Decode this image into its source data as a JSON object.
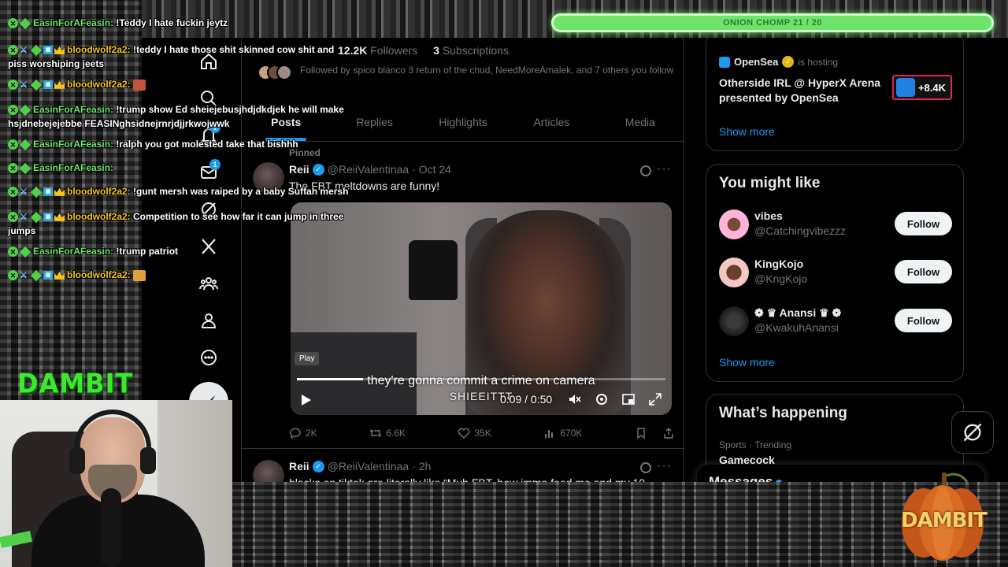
{
  "stream_overlay": {
    "chomp_bar_label": "ONION CHOMP 21 / 20",
    "channel_logo_text": "DAMBIT",
    "pumpkin_text": "DAMBIT",
    "colors": {
      "chat_green": "#6ee36a",
      "chat_gold": "#f5c518",
      "chomp_bar": "#6ee36a"
    }
  },
  "chat": {
    "messages": [
      {
        "user": "EasinForAFeasin:",
        "text": "!Teddy I hate fuckin jeytz",
        "style": "green"
      },
      {
        "user": "bloodwolf2a2:",
        "text": "!teddy I hate those shit skinned cow shit and piss worshiping jeets",
        "style": "gold"
      },
      {
        "user": "bloodwolf2a2:",
        "text": "",
        "style": "gold",
        "emote": true
      },
      {
        "user": "EasinForAFeasin:",
        "text": "!trump show Ed sheiejebusjhdjdkdjek he will make hsjdnebejejebbe FEASINghsidnejrnrjdjjrkwojwwk",
        "style": "green"
      },
      {
        "user": "EasinForAFeasin:",
        "text": "!ralph you got molested take that bishhh",
        "style": "green"
      },
      {
        "user": "EasinForAFeasin:",
        "text": "",
        "style": "green"
      },
      {
        "user": "bloodwolf2a2:",
        "text": "!gunt mersh was raiped by a baby Suffah mersh",
        "style": "gold"
      },
      {
        "user": "bloodwolf2a2:",
        "text": "Competition to see how far it can jump in three jumps",
        "style": "gold"
      },
      {
        "user": "EasinForAFeasin:",
        "text": "!trump patriot",
        "style": "green"
      },
      {
        "user": "bloodwolf2a2:",
        "text": "",
        "style": "gold",
        "emote": true
      }
    ]
  },
  "x_nav": {
    "icons": [
      "home-icon",
      "search-icon",
      "notifications-icon",
      "messages-icon",
      "grok-icon",
      "x-logo-icon",
      "communities-icon",
      "profile-icon",
      "more-icon"
    ],
    "notifications_badge": "1",
    "messages_badge": "1"
  },
  "profile": {
    "followers_count": "12.2K",
    "followers_label": "Followers",
    "subscriptions_count": "3",
    "subscriptions_label": "Subscriptions",
    "followed_by": "Followed by spico blanco 3 return of the chud, NeedMoreAmalek, and 7 others you follow",
    "tabs": [
      "Posts",
      "Replies",
      "Highlights",
      "Articles",
      "Media"
    ],
    "active_tab": "Posts"
  },
  "tweets": [
    {
      "pinned_label": "Pinned",
      "name": "Reii",
      "handle": "@ReiiValentinaa",
      "date": "· Oct 24",
      "text": "The FBT meltdowns are funny!",
      "video": {
        "caption": "they're gonna commit a crime on camera",
        "watermark": "SHIEEITTT",
        "play_tooltip": "Play",
        "time": "0:09 / 0:50",
        "progress": 0.18
      },
      "stats": {
        "replies": "2K",
        "reposts": "6.6K",
        "likes": "35K",
        "views": "670K"
      }
    },
    {
      "name": "Reii",
      "handle": "@ReiiValentinaa",
      "date": "· 2h",
      "text": "blacks on tiktok are literally like “Muh FBT, how imma feed me and my 10"
    }
  ],
  "sidebar": {
    "event": {
      "host_name": "OpenSea",
      "host_suffix": "is hosting",
      "title": "Otherside IRL @ HyperX Arena presented by OpenSea",
      "count": "+8.4K",
      "show_more": "Show more"
    },
    "you_might_like": {
      "title": "You might like",
      "accounts": [
        {
          "name": "vibes",
          "handle": "@Catchingvibezzz",
          "follow": "Follow"
        },
        {
          "name": "KingKojo",
          "handle": "@KngKojo",
          "follow": "Follow"
        },
        {
          "name": "❁ ♛ Anansi ♛ ❁",
          "handle": "@KwakuhAnansi",
          "follow": "Follow"
        }
      ],
      "show_more": "Show more"
    },
    "happening": {
      "title": "What’s happening",
      "trend_meta": "Sports · Trending",
      "trend_name": "Gamecock"
    },
    "messages_label": "Messages"
  }
}
